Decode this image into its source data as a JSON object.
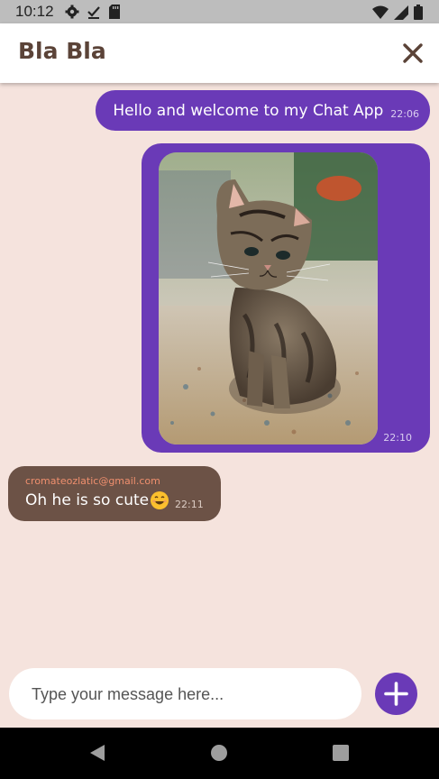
{
  "status_bar": {
    "time": "10:12",
    "icons_left": [
      "settings-icon",
      "download-done-icon",
      "sd-card-icon"
    ],
    "icons_right": [
      "wifi-icon",
      "signal-icon",
      "battery-icon"
    ]
  },
  "header": {
    "title": "Bla Bla",
    "close_icon": "close-icon"
  },
  "messages": [
    {
      "direction": "outgoing",
      "text": "Hello and welcome to my Chat App",
      "time": "22:06"
    },
    {
      "direction": "outgoing",
      "type": "image",
      "image": "kitten-photo",
      "time": "22:10"
    },
    {
      "direction": "incoming",
      "sender": "cromateozlatic@gmail.com",
      "text": "Oh he is so cute",
      "emoji": "smiling-face-emoji",
      "time": "22:11"
    }
  ],
  "composer": {
    "placeholder": "Type your message here...",
    "value": "",
    "send_icon": "plus-icon"
  },
  "nav_bar": {
    "icons": [
      "back-icon",
      "home-icon",
      "recents-icon"
    ]
  },
  "colors": {
    "background": "#f5e3dd",
    "outgoing_bubble": "#6a3ab7",
    "incoming_bubble": "#6c5246",
    "title": "#5b4338",
    "sender_email": "#ef8f6e"
  }
}
